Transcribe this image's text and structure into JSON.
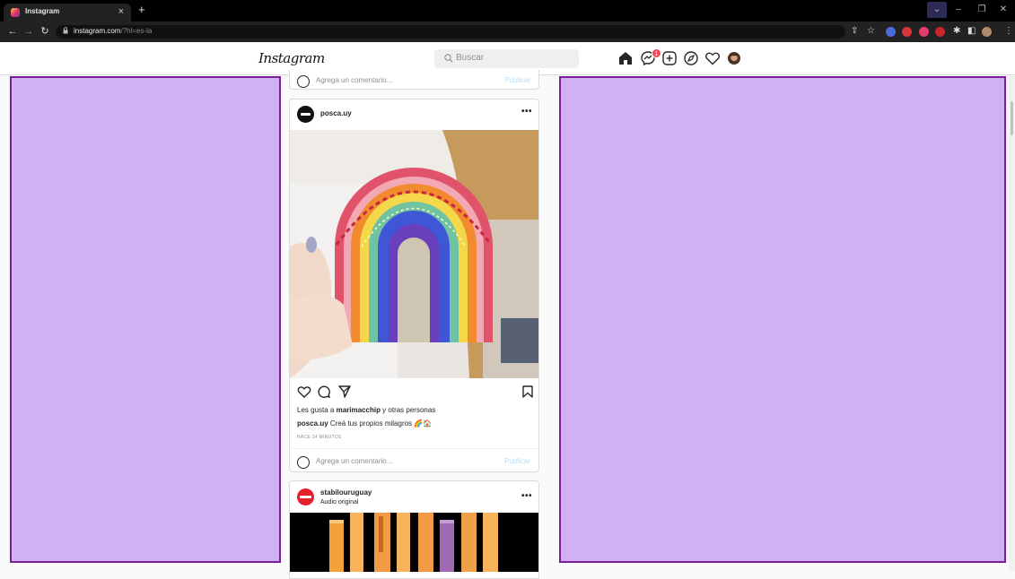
{
  "browser": {
    "tab_title": "Instagram",
    "tab_close": "×",
    "new_tab": "+",
    "url_host": "instagram.com",
    "url_path": "/?hl=es-la",
    "window_controls": [
      "⌄",
      "–",
      "❐",
      "✕"
    ],
    "nav_icons": [
      "back-icon",
      "forward-icon",
      "reload-icon"
    ]
  },
  "header": {
    "logo": "Instagram",
    "search_placeholder": "Buscar",
    "notification_count": "1",
    "icons": [
      "home-icon",
      "messenger-icon",
      "new-post-icon",
      "explore-icon",
      "activity-heart-icon",
      "profile-avatar"
    ]
  },
  "feed": {
    "top_comment_placeholder": "Agrega un comentario...",
    "top_publish": "Publicar",
    "post1": {
      "username": "posca.uy",
      "likes_text_prefix": "Les gusta a ",
      "likes_user": "marimacchip",
      "likes_suffix": " y otras personas",
      "caption_user": "posca.uy",
      "caption_text": " Creá tus propios milagros 🌈🏠",
      "timestamp": "HACE 24 MINUTOS",
      "comment_placeholder": "Agrega un comentario...",
      "publish": "Publicar"
    },
    "post2": {
      "username": "stabilouruguay",
      "subtitle": "Audio original"
    }
  },
  "colors": {
    "panel_fill": "#d1b1f2",
    "panel_border": "#7a1e9a",
    "notification_red": "#ed4956"
  }
}
